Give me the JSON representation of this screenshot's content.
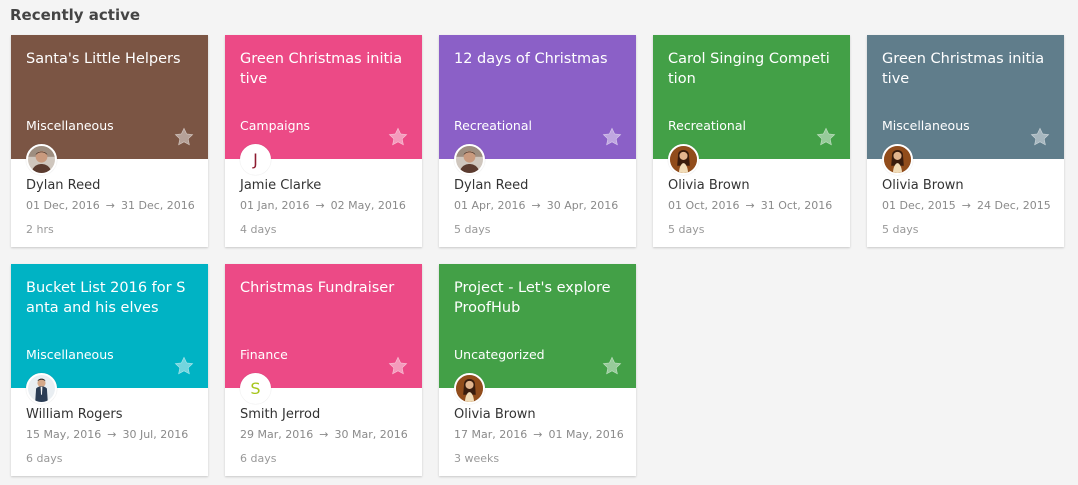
{
  "section_title": "Recently active",
  "cards": [
    {
      "title": "Santa's Little Helpers",
      "category": "Miscellaneous",
      "color": "#7b5544",
      "owner": "Dylan Reed",
      "avatar": "photo-male",
      "start": "01 Dec, 2016",
      "end": "31 Dec, 2016",
      "duration": "2 hrs"
    },
    {
      "title": "Green Christmas initiative",
      "category": "Campaigns",
      "color": "#ec4a86",
      "owner": "Jamie Clarke",
      "avatar": "letter",
      "avatar_letter": "J",
      "avatar_color": "#8e1b30",
      "start": "01 Jan, 2016",
      "end": "02 May, 2016",
      "duration": "4 days"
    },
    {
      "title": "12 days of Christmas",
      "category": "Recreational",
      "color": "#8b60c7",
      "owner": "Dylan Reed",
      "avatar": "photo-male",
      "start": "01 Apr, 2016",
      "end": "30 Apr, 2016",
      "duration": "5 days"
    },
    {
      "title": "Carol Singing Competition",
      "category": "Recreational",
      "color": "#43a047",
      "owner": "Olivia Brown",
      "avatar": "photo-female",
      "start": "01 Oct, 2016",
      "end": "31 Oct, 2016",
      "duration": "5 days"
    },
    {
      "title": "Green Christmas initiative",
      "category": "Miscellaneous",
      "color": "#607d8b",
      "owner": "Olivia Brown",
      "avatar": "photo-female",
      "start": "01 Dec, 2015",
      "end": "24 Dec, 2015",
      "duration": "5 days"
    },
    {
      "title": "Bucket List 2016 for Santa and his elves",
      "category": "Miscellaneous",
      "color": "#00b3c4",
      "owner": "William Rogers",
      "avatar": "photo-suit",
      "start": "15 May, 2016",
      "end": "30 Jul, 2016",
      "duration": "6 days"
    },
    {
      "title": "Christmas Fundraiser",
      "category": "Finance",
      "color": "#ec4a86",
      "owner": "Smith Jerrod",
      "avatar": "letter",
      "avatar_letter": "S",
      "avatar_color": "#a6c51a",
      "start": "29 Mar, 2016",
      "end": "30 Mar, 2016",
      "duration": "6 days"
    },
    {
      "title": "Project - Let's explore ProofHub",
      "category": "Uncategorized",
      "color": "#43a047",
      "owner": "Olivia Brown",
      "avatar": "photo-female",
      "start": "17 Mar, 2016",
      "end": "01 May, 2016",
      "duration": "3 weeks"
    }
  ]
}
